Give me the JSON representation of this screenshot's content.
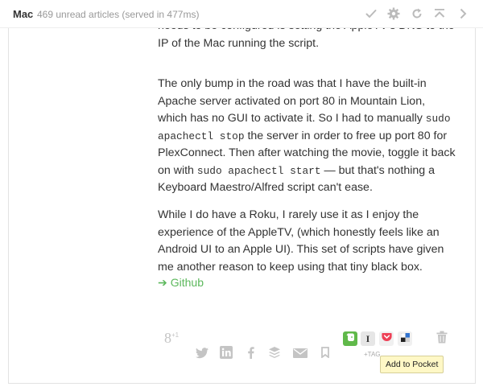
{
  "header": {
    "feed_title": "Mac",
    "unread_status": "469 unread articles (served in 477ms)",
    "icons": [
      "check-icon",
      "gear-icon",
      "refresh-icon",
      "scroll-top-icon",
      "next-icon"
    ]
  },
  "article": {
    "cut_text": "needs to be configured is setting the AppleTV's DNS to the IP of the Mac running the script.",
    "p1_a": "The only bump in the road was that I have the built-in Apache server activated on port 80 in Mountain Lion, which has no GUI to activate it. So I had to manually ",
    "p1_code1": "sudo apachectl stop",
    "p1_b": " the server in order to free up port 80 for PlexConnect. Then after watching the movie, toggle it back on with ",
    "p1_code2": "sudo apachectl start",
    "p1_c": " — but that's nothing a Keyboard Maestro/Alfred script can't ease.",
    "p2": "While I do have a Roku, I rarely use it as I enjoy the experience of the AppleTV, (which honestly feels like an Android UI to an Apple UI). This set of scripts have given me another reason to keep using that tiny black box.",
    "link_arrow": "➔",
    "link_text": "Github"
  },
  "share": {
    "gplus": "8",
    "gplus_count": "+1",
    "instapaper_label": "I",
    "tag_label": "+TAG",
    "tooltip": "Add to Pocket",
    "icons": [
      "twitter-icon",
      "linkedin-icon",
      "facebook-icon",
      "buffer-icon",
      "email-icon",
      "bookmark-icon"
    ]
  },
  "colors": {
    "link": "#5cb85c",
    "evernote": "#60b94a",
    "pocket": "#ee4056",
    "tooltip_bg": "#fff8c6"
  }
}
